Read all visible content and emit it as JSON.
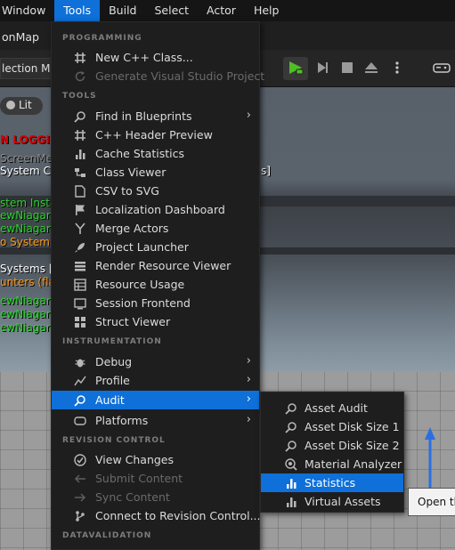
{
  "menubar": {
    "items": [
      {
        "label": "Window",
        "active": false
      },
      {
        "label": "Tools",
        "active": true
      },
      {
        "label": "Build",
        "active": false
      },
      {
        "label": "Select",
        "active": false
      },
      {
        "label": "Actor",
        "active": false
      },
      {
        "label": "Help",
        "active": false
      }
    ]
  },
  "level_tab": {
    "label": "onMap"
  },
  "toolbar": {
    "selection_mode": "lection Mo"
  },
  "viewport": {
    "lit_label": "Lit",
    "overlay_lines": [
      {
        "text": "N LOGGIN",
        "color": "#e00000"
      },
      {
        "text": "ScreenMe",
        "color": "#8a8a8a"
      },
      {
        "text": "System Co",
        "color": "#ffffff",
        "suffix": "s]"
      },
      {
        "text": "stem Insta",
        "color": "#2bd62b"
      },
      {
        "text": "ewNiagar",
        "color": "#2bd62b"
      },
      {
        "text": "ewNiagar",
        "color": "#2bd62b"
      },
      {
        "text": "o System I",
        "color": "#ff9b1a"
      },
      {
        "text": "Systems [",
        "color": "#ffffff"
      },
      {
        "text": "unters (fla",
        "color": "#ff9b1a"
      },
      {
        "text": "ewNiagar",
        "color": "#2bd62b"
      },
      {
        "text": "ewNiagar",
        "color": "#2bd62b"
      },
      {
        "text": "ewNiagar",
        "color": "#2bd62b"
      }
    ]
  },
  "tools_menu": {
    "sections": {
      "programming": "PROGRAMMING",
      "tools": "TOOLS",
      "instrumentation": "INSTRUMENTATION",
      "revision_control": "REVISION CONTROL",
      "datavalidation": "DATAVALIDATION"
    },
    "items": {
      "new_cpp_class": "New C++ Class...",
      "generate_vs": "Generate Visual Studio Project",
      "find_in_blueprints": "Find in Blueprints",
      "cpp_header_preview": "C++ Header Preview",
      "cache_statistics": "Cache Statistics",
      "class_viewer": "Class Viewer",
      "csv_to_svg": "CSV to SVG",
      "localization_dashboard": "Localization Dashboard",
      "merge_actors": "Merge Actors",
      "project_launcher": "Project Launcher",
      "render_resource_viewer": "Render Resource Viewer",
      "resource_usage": "Resource Usage",
      "session_frontend": "Session Frontend",
      "struct_viewer": "Struct Viewer",
      "debug": "Debug",
      "profile": "Profile",
      "audit": "Audit",
      "platforms": "Platforms",
      "view_changes": "View Changes",
      "submit_content": "Submit Content",
      "sync_content": "Sync Content",
      "connect_revision_control": "Connect to Revision Control..."
    }
  },
  "audit_submenu": {
    "items": [
      {
        "label": "Asset Audit",
        "icon": "audit-search-icon"
      },
      {
        "label": "Asset Disk Size 1",
        "icon": "audit-search-icon"
      },
      {
        "label": "Asset Disk Size 2",
        "icon": "audit-search-icon"
      },
      {
        "label": "Material Analyzer",
        "icon": "material-analyzer-icon"
      },
      {
        "label": "Statistics",
        "icon": "statistics-icon",
        "selected": true
      },
      {
        "label": "Virtual Assets",
        "icon": "statistics-icon"
      }
    ]
  },
  "tooltip": {
    "text": "Open th"
  },
  "colors": {
    "accent": "#0e70d8",
    "menu_bg": "#1e1e1e",
    "play_green": "#4fbf26"
  }
}
